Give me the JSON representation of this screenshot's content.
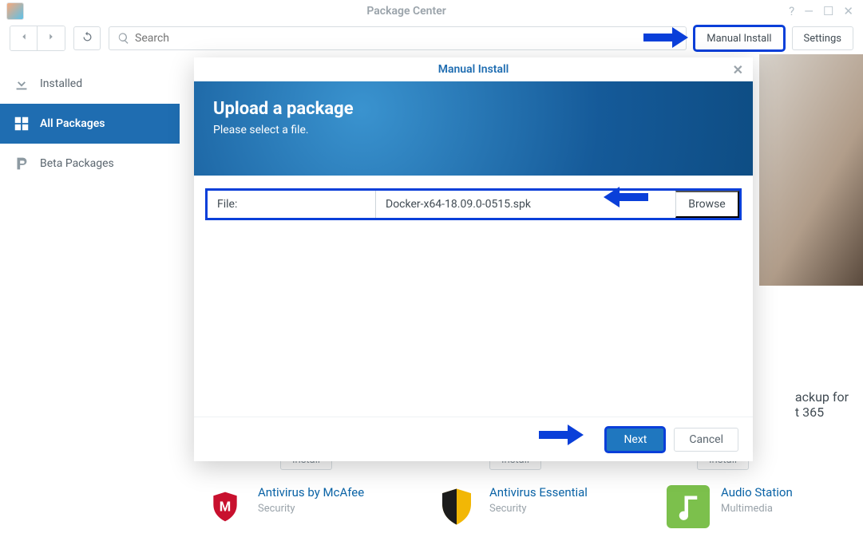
{
  "window": {
    "title": "Package Center"
  },
  "toolbar": {
    "search_placeholder": "Search",
    "manual_install": "Manual Install",
    "settings": "Settings"
  },
  "sidebar": {
    "items": [
      {
        "label": "Installed"
      },
      {
        "label": "All Packages"
      },
      {
        "label": "Beta Packages"
      }
    ]
  },
  "main": {
    "teaser_title_line1": "ackup for",
    "teaser_title_line2": "t 365",
    "install_label": "Install",
    "cards": [
      {
        "title": "Antivirus by McAfee",
        "category": "Security"
      },
      {
        "title": "Antivirus Essential",
        "category": "Security"
      },
      {
        "title": "Audio Station",
        "category": "Multimedia"
      }
    ]
  },
  "modal": {
    "title": "Manual Install",
    "heading": "Upload a package",
    "subheading": "Please select a file.",
    "file_label": "File:",
    "file_value": "Docker-x64-18.09.0-0515.spk",
    "browse": "Browse",
    "next": "Next",
    "cancel": "Cancel"
  }
}
